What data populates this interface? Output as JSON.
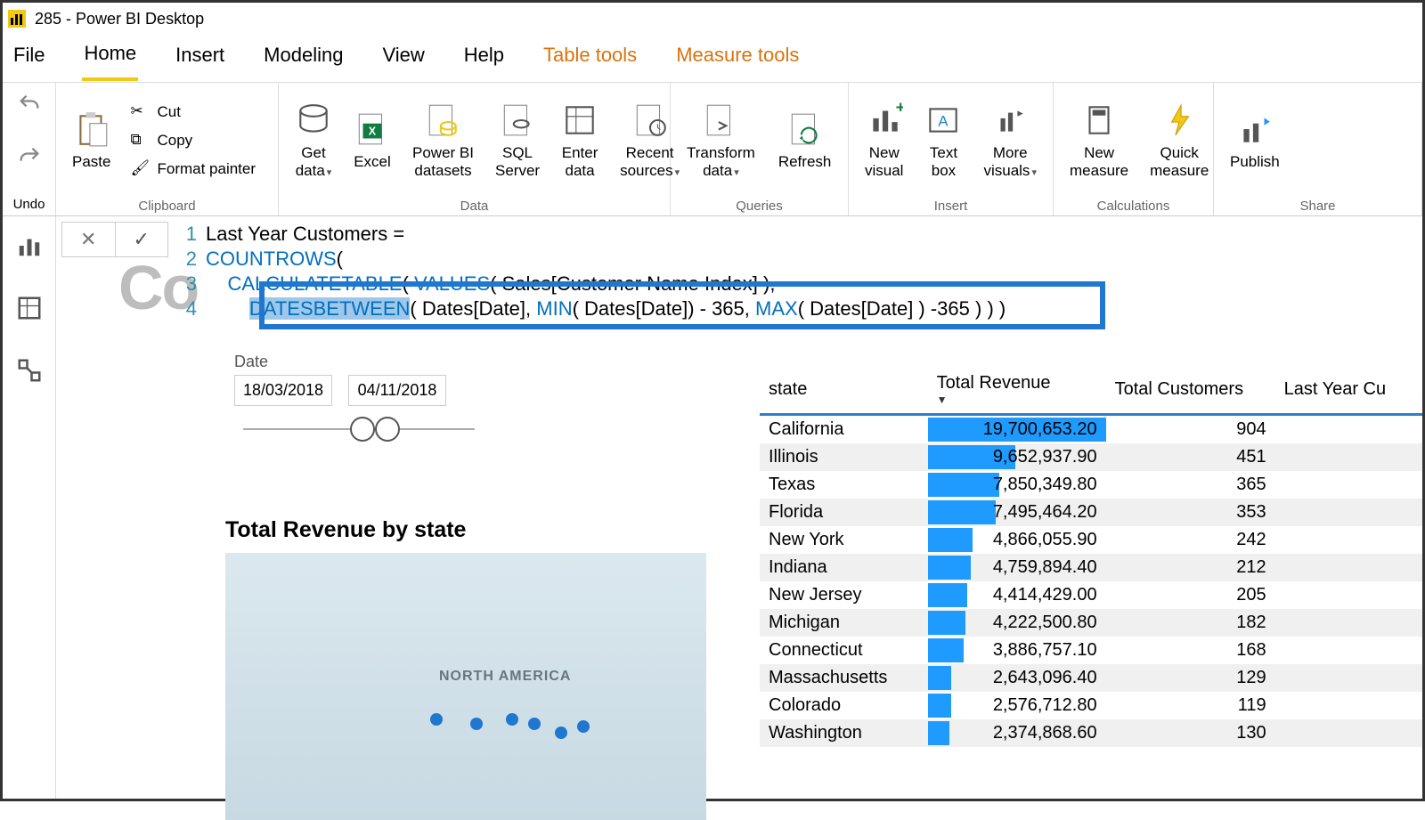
{
  "title": "285 - Power BI Desktop",
  "menu": {
    "file": "File",
    "home": "Home",
    "insert": "Insert",
    "modeling": "Modeling",
    "view": "View",
    "help": "Help",
    "tabletools": "Table tools",
    "measuretools": "Measure tools"
  },
  "ribbon": {
    "undo": "Undo",
    "clipboard": {
      "label": "Clipboard",
      "paste": "Paste",
      "cut": "Cut",
      "copy": "Copy",
      "format": "Format painter"
    },
    "data": {
      "label": "Data",
      "get": "Get\ndata",
      "excel": "Excel",
      "pbi": "Power BI\ndatasets",
      "sql": "SQL\nServer",
      "enter": "Enter\ndata",
      "recent": "Recent\nsources"
    },
    "queries": {
      "label": "Queries",
      "transform": "Transform\ndata",
      "refresh": "Refresh"
    },
    "insert": {
      "label": "Insert",
      "newvis": "New\nvisual",
      "textbox": "Text\nbox",
      "more": "More\nvisuals"
    },
    "calc": {
      "label": "Calculations",
      "newmeasure": "New\nmeasure",
      "quick": "Quick\nmeasure"
    },
    "share": {
      "label": "Share",
      "publish": "Publish"
    }
  },
  "formula": {
    "l1": "Last Year Customers =",
    "l2a": "COUNTROWS",
    "l2b": "(",
    "l3a": "CALCULATETABLE",
    "l3b": "( ",
    "l3c": "VALUES",
    "l3d": "( Sales[Customer Name Index] ),",
    "l4a": "DATESBETWEEN",
    "l4b": "( Dates[Date], ",
    "l4c": "MIN",
    "l4d": "( Dates[Date]) - 365, ",
    "l4e": "MAX",
    "l4f": "( Dates[Date] ) -365 ) ) )"
  },
  "ghost": "Co",
  "slicer": {
    "label": "Date",
    "from": "18/03/2018",
    "to": "04/11/2018"
  },
  "mapTitle": "Total Revenue by state",
  "mapLabel": "NORTH AMERICA",
  "table": {
    "headers": {
      "state": "state",
      "rev": "Total Revenue",
      "cust": "Total Customers",
      "ly": "Last Year Cu"
    },
    "rows": [
      {
        "state": "California",
        "rev": "19,700,653.20",
        "cust": "904",
        "bar": 100
      },
      {
        "state": "Illinois",
        "rev": "9,652,937.90",
        "cust": "451",
        "bar": 49
      },
      {
        "state": "Texas",
        "rev": "7,850,349.80",
        "cust": "365",
        "bar": 40
      },
      {
        "state": "Florida",
        "rev": "7,495,464.20",
        "cust": "353",
        "bar": 38
      },
      {
        "state": "New York",
        "rev": "4,866,055.90",
        "cust": "242",
        "bar": 25
      },
      {
        "state": "Indiana",
        "rev": "4,759,894.40",
        "cust": "212",
        "bar": 24
      },
      {
        "state": "New Jersey",
        "rev": "4,414,429.00",
        "cust": "205",
        "bar": 22
      },
      {
        "state": "Michigan",
        "rev": "4,222,500.80",
        "cust": "182",
        "bar": 21
      },
      {
        "state": "Connecticut",
        "rev": "3,886,757.10",
        "cust": "168",
        "bar": 20
      },
      {
        "state": "Massachusetts",
        "rev": "2,643,096.40",
        "cust": "129",
        "bar": 13
      },
      {
        "state": "Colorado",
        "rev": "2,576,712.80",
        "cust": "119",
        "bar": 13
      },
      {
        "state": "Washington",
        "rev": "2,374,868.60",
        "cust": "130",
        "bar": 12
      }
    ]
  },
  "chart_data": {
    "type": "table",
    "title": "Total Revenue by state",
    "columns": [
      "state",
      "Total Revenue",
      "Total Customers"
    ],
    "rows": [
      [
        "California",
        19700653.2,
        904
      ],
      [
        "Illinois",
        9652937.9,
        451
      ],
      [
        "Texas",
        7850349.8,
        365
      ],
      [
        "Florida",
        7495464.2,
        353
      ],
      [
        "New York",
        4866055.9,
        242
      ],
      [
        "Indiana",
        4759894.4,
        212
      ],
      [
        "New Jersey",
        4414429.0,
        205
      ],
      [
        "Michigan",
        4222500.8,
        182
      ],
      [
        "Connecticut",
        3886757.1,
        168
      ],
      [
        "Massachusetts",
        2643096.4,
        129
      ],
      [
        "Colorado",
        2576712.8,
        119
      ],
      [
        "Washington",
        2374868.6,
        130
      ]
    ]
  }
}
